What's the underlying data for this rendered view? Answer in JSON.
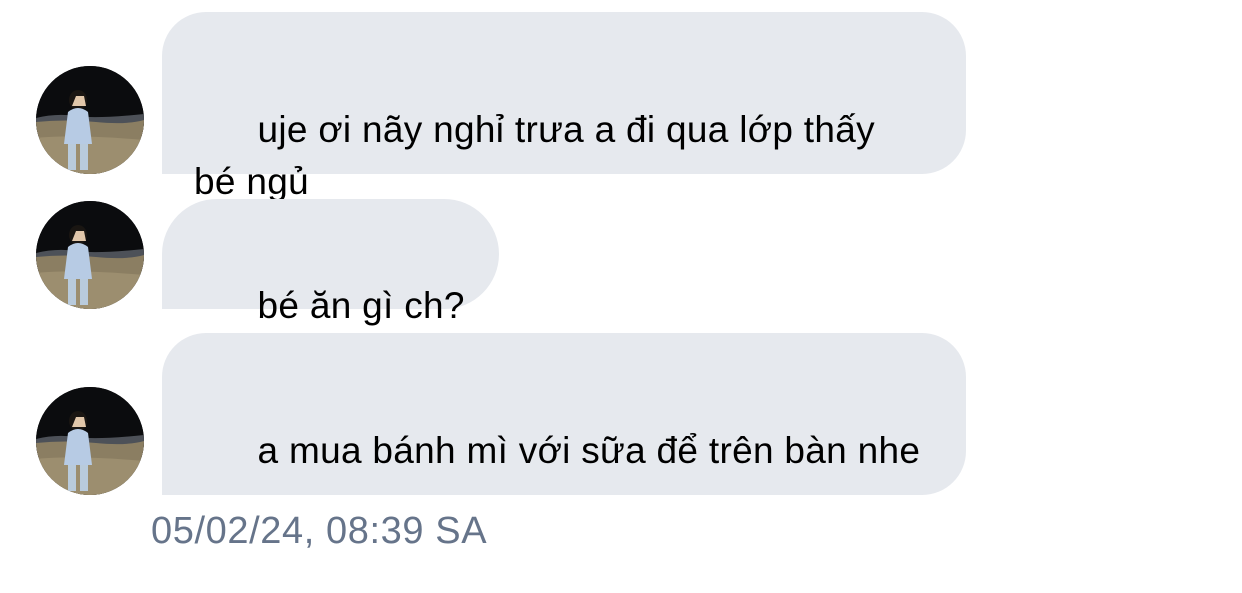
{
  "conversation": {
    "messages": [
      {
        "sender_avatar": "profile-photo",
        "text": "uje ơi nãy nghỉ trưa a đi qua lớp thấy bé ngủ"
      },
      {
        "sender_avatar": "profile-photo",
        "text": "bé ăn gì ch?"
      },
      {
        "sender_avatar": "profile-photo",
        "text": "a mua bánh mì với sữa để trên bàn nhe"
      }
    ],
    "timestamp": "05/02/24, 08:39 SA"
  },
  "colors": {
    "bubble_background": "#e6e9ee",
    "message_text": "#000000",
    "timestamp_text": "#66748a",
    "page_background": "#ffffff"
  }
}
